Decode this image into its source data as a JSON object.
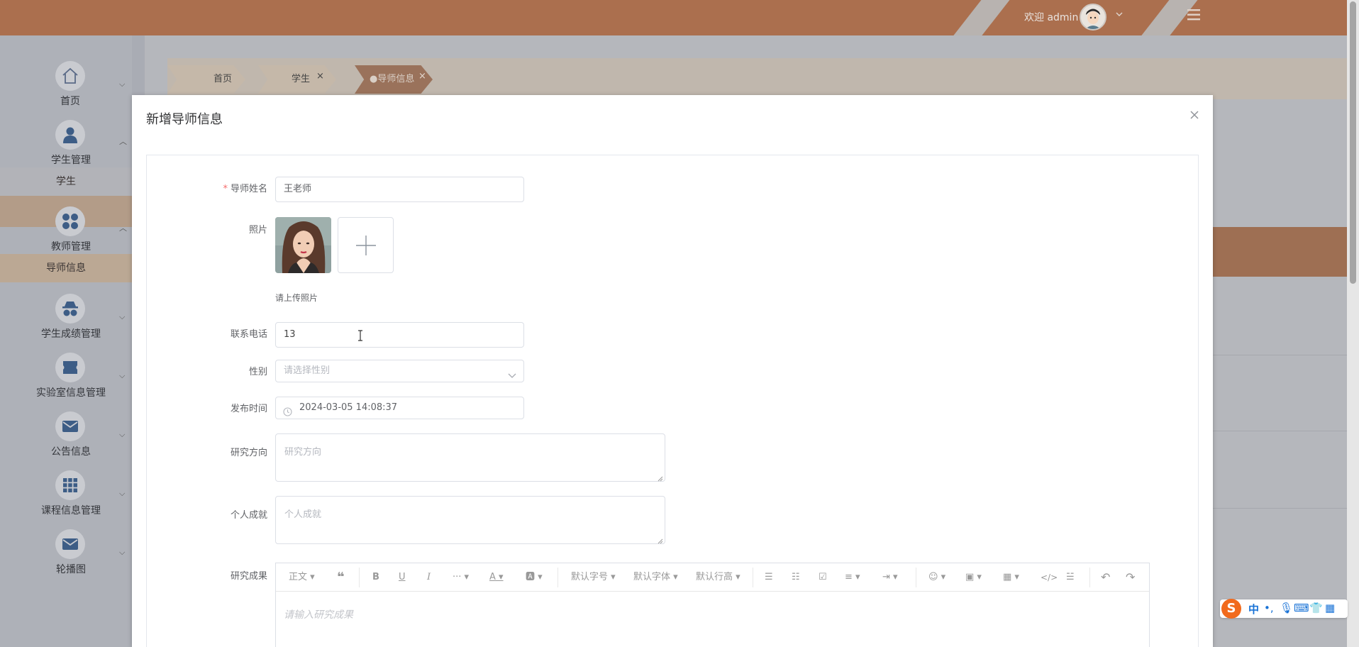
{
  "header": {
    "welcome": "欢迎 admin",
    "colors": {
      "brand": "#ab6f4e"
    },
    "icons": {
      "avatar": "user-avatar-icon",
      "menu": "hamburger-menu-icon"
    }
  },
  "sidebar": {
    "items": [
      {
        "label": "首页",
        "icon": "home-icon"
      },
      {
        "label": "学生管理",
        "icon": "person-icon",
        "sub": "学生"
      },
      {
        "label": "教师管理",
        "icon": "grid-dots-icon",
        "sub": "导师信息"
      },
      {
        "label": "学生成绩管理",
        "icon": "spy-icon"
      },
      {
        "label": "实验室信息管理",
        "icon": "ticket-icon"
      },
      {
        "label": "公告信息",
        "icon": "mail-icon"
      },
      {
        "label": "课程信息管理",
        "icon": "apps-icon"
      },
      {
        "label": "轮播图",
        "icon": "mail-icon"
      }
    ]
  },
  "tabs": [
    {
      "label": "首页"
    },
    {
      "label": "学生",
      "close": "×"
    },
    {
      "label": "●导师信息",
      "close": "×"
    }
  ],
  "modal": {
    "title": "新增导师信息",
    "form": {
      "name": {
        "label": "导师姓名",
        "required_mark": "*",
        "value": "王老师"
      },
      "photo": {
        "label": "照片",
        "tip": "请上传照片"
      },
      "phone": {
        "label": "联系电话",
        "value": "13"
      },
      "gender": {
        "label": "性别",
        "placeholder": "请选择性别"
      },
      "publish_time": {
        "label": "发布时间",
        "value": "2024-03-05 14:08:37"
      },
      "research_direction": {
        "label": "研究方向",
        "placeholder": "研究方向"
      },
      "achievement": {
        "label": "个人成就",
        "placeholder": "个人成就"
      },
      "research_results": {
        "label": "研究成果",
        "placeholder": "请输入研究成果",
        "toolbar": {
          "paragraph": "正文",
          "font_size": "默认字号",
          "font_family": "默认字体",
          "line_height": "默认行高",
          "more": "···"
        }
      }
    }
  },
  "ime": {
    "lang": "中"
  }
}
